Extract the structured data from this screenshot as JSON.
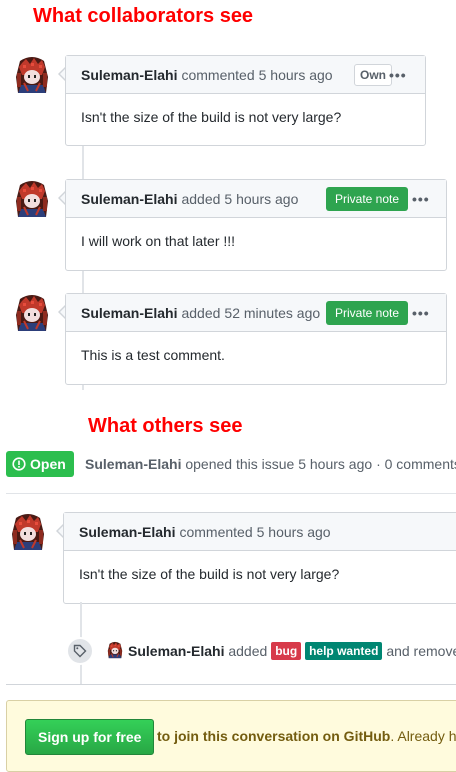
{
  "headings": {
    "collaborators": "What collaborators see",
    "others": "What others see"
  },
  "collab_comments": [
    {
      "author": "Suleman-Elahi",
      "action": "commented",
      "time": "5 hours ago",
      "badge": "Own",
      "body": "Isn't the size of the build is not very large?"
    },
    {
      "author": "Suleman-Elahi",
      "action": "added",
      "time": "5 hours ago",
      "badge": "Private note",
      "body": "I will work on that later !!!"
    },
    {
      "author": "Suleman-Elahi",
      "action": "added",
      "time": "52 minutes ago",
      "badge": "Private note",
      "body": "This is a test comment."
    }
  ],
  "issue": {
    "status": "Open",
    "author": "Suleman-Elahi",
    "opened_text": "opened this issue 5 hours ago",
    "separator": "·",
    "comments_text": "0 comments"
  },
  "public_comment": {
    "author": "Suleman-Elahi",
    "action": "commented",
    "time": "5 hours ago",
    "body": "Isn't the size of the build is not very large?"
  },
  "label_event": {
    "author": "Suleman-Elahi",
    "action": "added",
    "labels": [
      {
        "name": "bug",
        "color": "#d73a4a"
      },
      {
        "name": "help wanted",
        "color": "#008672"
      }
    ],
    "trailing": "and remove"
  },
  "join": {
    "button": "Sign up for free",
    "text": "to join this conversation on GitHub",
    "trailing": ". Already h"
  },
  "menu_glyph": "•••",
  "colors": {
    "heading": "#ff0000",
    "private_note": "#2ea44f",
    "open": "#2cbe4e"
  }
}
